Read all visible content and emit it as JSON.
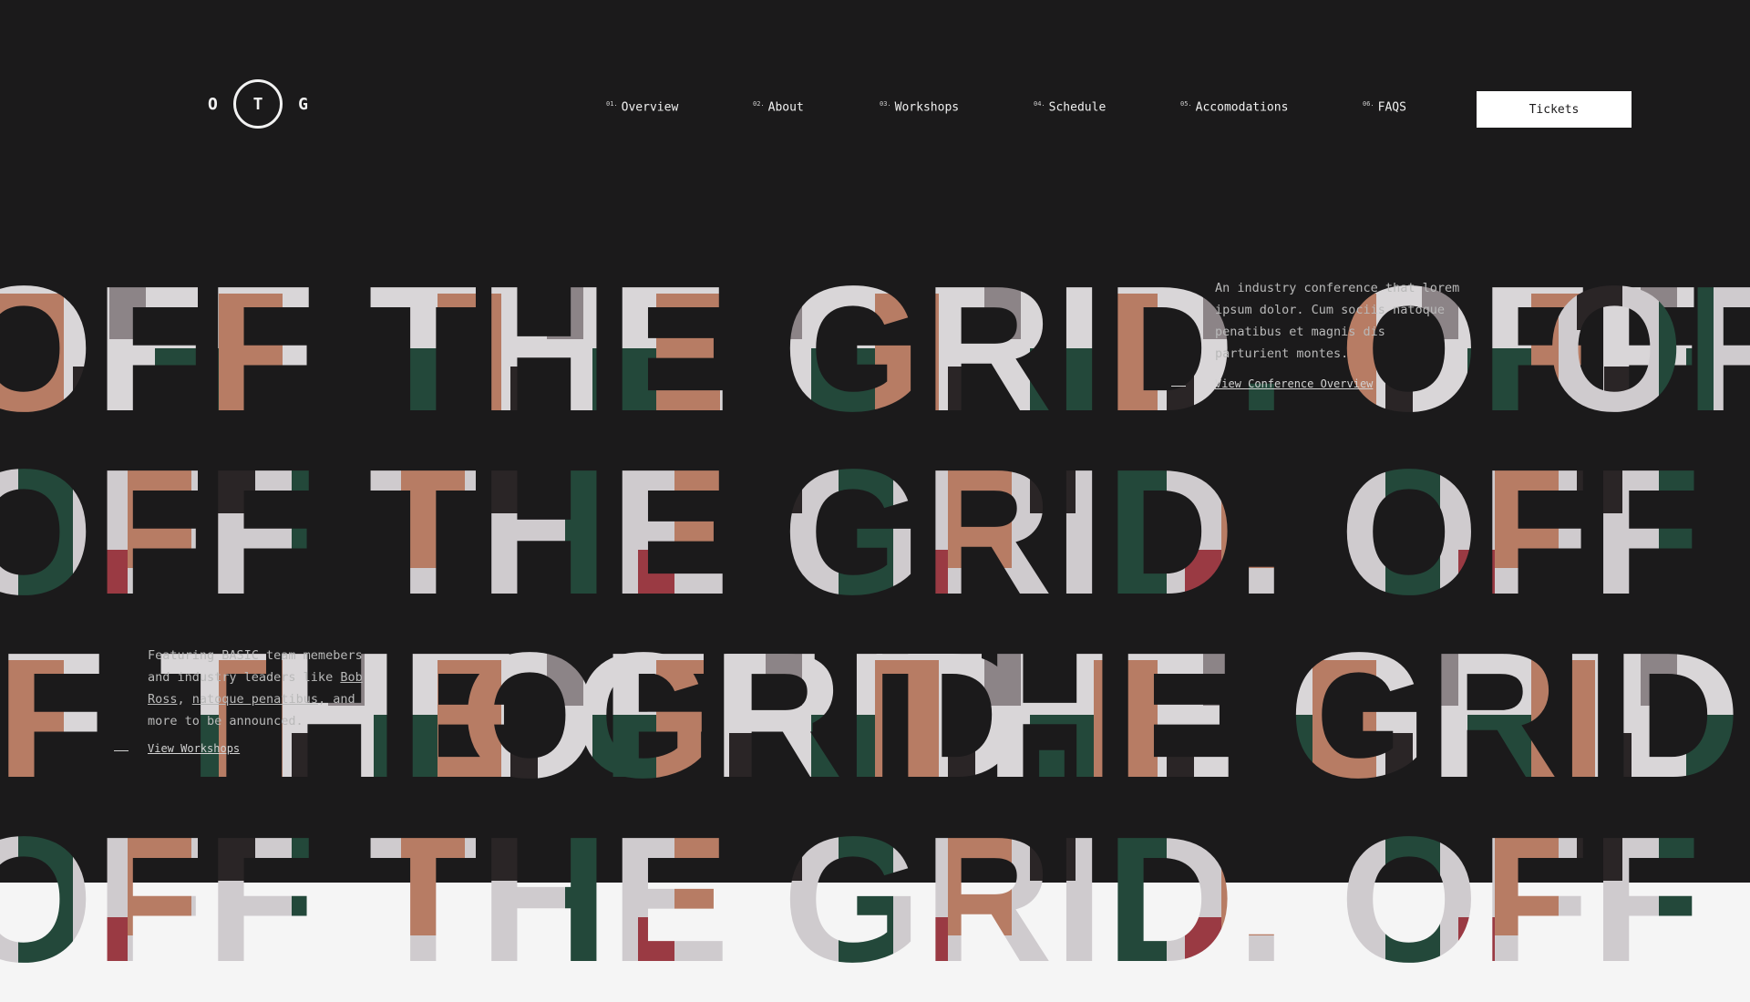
{
  "logo": {
    "left": "O",
    "center": "T",
    "right": "G"
  },
  "nav": {
    "items": [
      {
        "num": "01.",
        "label": "Overview"
      },
      {
        "num": "02.",
        "label": "About"
      },
      {
        "num": "03.",
        "label": "Workshops"
      },
      {
        "num": "04.",
        "label": "Schedule"
      },
      {
        "num": "05.",
        "label": "Accomodations"
      },
      {
        "num": "06.",
        "label": "FAQS"
      }
    ],
    "tickets_label": "Tickets"
  },
  "hero": {
    "phrase": "OFF THE GRID.",
    "colors": {
      "background": "#1b1a1b",
      "letter_fill_light": "#d9d6d8",
      "letter_fill_skin": "#b77c64",
      "letter_fill_green": "#23483a",
      "band": "#f5f5f5"
    }
  },
  "overview": {
    "text": "An industry conference that lorem ipsum dolor. Cum sociis natoque penatibus et magnis dis parturient montes.",
    "link": "View Conference Overview"
  },
  "workshops": {
    "text_before": "Featuring BASIC team memebers and industry leaders like ",
    "name1": "Bob Ross",
    "sep": ", ",
    "name2": "natoque penatibus",
    "text_after": ", and more to be announced.",
    "link": "View Workshops"
  }
}
